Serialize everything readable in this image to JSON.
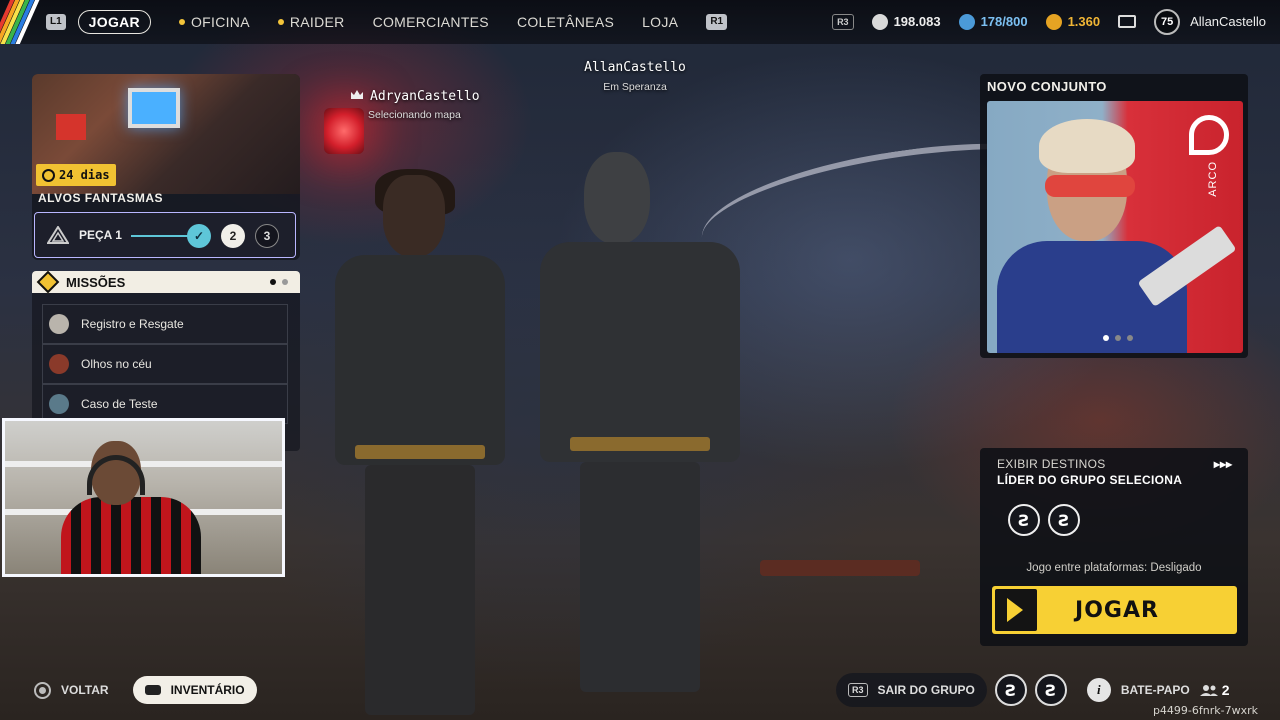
{
  "nav": {
    "left_trigger": "L1",
    "right_trigger": "R1",
    "items": [
      {
        "label": "JOGAR",
        "active": true,
        "dot": false
      },
      {
        "label": "OFICINA",
        "active": false,
        "dot": true
      },
      {
        "label": "RAIDER",
        "active": false,
        "dot": true
      },
      {
        "label": "COMERCIANTES",
        "active": false,
        "dot": false
      },
      {
        "label": "COLETÂNEAS",
        "active": false,
        "dot": false
      },
      {
        "label": "LOJA",
        "active": false,
        "dot": false
      }
    ]
  },
  "header": {
    "r3_label": "R3",
    "coins": "198.083",
    "capacity": "178/800",
    "premium": "1.360",
    "level": "75",
    "username": "AllanCastello"
  },
  "players": {
    "center": {
      "name": "AllanCastello",
      "status": "Em Speranza"
    },
    "left": {
      "name": "AdryanCastello",
      "status": "Selecionando mapa"
    }
  },
  "event": {
    "timer": "24 dias",
    "title": "ALVOS FANTASMAS",
    "piece_label": "PEÇA 1",
    "steps": [
      "2",
      "3"
    ],
    "check": "✓"
  },
  "missions": {
    "title": "MISSÕES",
    "items": [
      {
        "label": "Registro e Resgate"
      },
      {
        "label": "Olhos no céu"
      },
      {
        "label": "Caso de Teste"
      }
    ]
  },
  "new_set": {
    "title": "NOVO CONJUNTO",
    "brand": "ARCO"
  },
  "deploy": {
    "line1": "EXIBIR DESTINOS",
    "line2": "LÍDER DO GRUPO SELECIONA",
    "arrows": "▸▸▸",
    "crossplay": "Jogo entre plataformas: Desligado",
    "play_label": "JOGAR"
  },
  "bottom": {
    "back_label": "VOLTAR",
    "inventory_label": "INVENTÁRIO",
    "r3_label": "R3",
    "leave_group": "SAIR DO GRUPO",
    "chat_label": "BATE-PAPO",
    "info_icon": "i",
    "group_count": "2",
    "session_code": "p4499-6fnrk-7wxrk"
  },
  "colors": {
    "accent_yellow": "#f7d034",
    "progress_teal": "#5ec6d8",
    "stripes": [
      "#e63a2e",
      "#f6a623",
      "#f7e24a",
      "#3bb54a",
      "#2b7de1",
      "#ffffff"
    ]
  }
}
